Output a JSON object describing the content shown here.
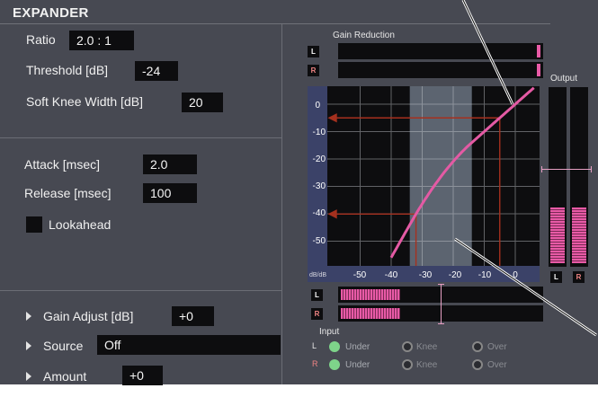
{
  "title": "EXPANDER",
  "params": {
    "ratio": {
      "label": "Ratio",
      "value": "2.0 : 1"
    },
    "threshold": {
      "label": "Threshold [dB]",
      "value": "-24"
    },
    "knee": {
      "label": "Soft Knee Width [dB]",
      "value": "20"
    },
    "attack": {
      "label": "Attack [msec]",
      "value": "2.0"
    },
    "release": {
      "label": "Release [msec]",
      "value": "100"
    },
    "lookahead": {
      "label": "Lookahead"
    },
    "gain_adjust": {
      "label": "Gain Adjust [dB]",
      "value": "+0"
    },
    "source": {
      "label": "Source",
      "value": "Off"
    },
    "amount": {
      "label": "Amount",
      "value": "+0"
    }
  },
  "gain_reduction": {
    "label": "Gain Reduction",
    "l": "L",
    "r": "R"
  },
  "output": {
    "label": "Output",
    "l": "L",
    "r": "R"
  },
  "input": {
    "label": "Input",
    "l": "L",
    "r": "R"
  },
  "graph": {
    "y_ticks": [
      "0",
      "-10",
      "-20",
      "-30",
      "-40",
      "-50"
    ],
    "x_ticks": [
      "-50",
      "-40",
      "-30",
      "-20",
      "-10",
      "0"
    ],
    "unit_label": "dB/dB"
  },
  "indicators": {
    "l": {
      "under": "Under",
      "knee": "Knee",
      "over": "Over"
    },
    "r": {
      "under": "Under",
      "knee": "Knee",
      "over": "Over"
    }
  },
  "colors": {
    "curve": "#e45aa4",
    "guide": "#a5301e",
    "knee_zone": "#5c6470",
    "active_indicator": "#7ed48a"
  }
}
